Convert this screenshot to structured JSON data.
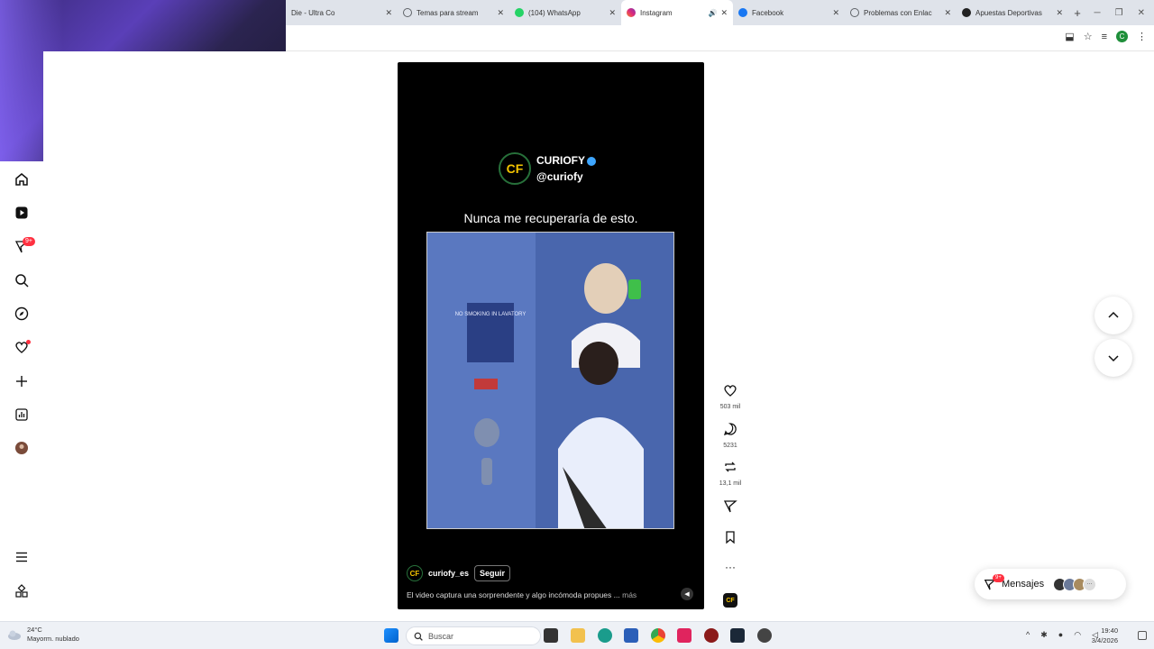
{
  "browser": {
    "tabs": [
      {
        "title": "Die - Ultra Co",
        "color": "#888888",
        "active": false
      },
      {
        "title": "Temas para stream",
        "color": "#5f6368",
        "active": false
      },
      {
        "title": "(104) WhatsApp",
        "color": "#25d366",
        "active": false
      },
      {
        "title": "Instagram",
        "color": "#e1306c",
        "active": true
      },
      {
        "title": "Facebook",
        "color": "#1877f2",
        "active": false
      },
      {
        "title": "Problemas con Enlac",
        "color": "#5f6368",
        "active": false
      },
      {
        "title": "Apuestas Deportivas",
        "color": "#222222",
        "active": false
      }
    ],
    "new_tab": "+",
    "profile_initial": "C"
  },
  "sidebar": {
    "notifications_badge": "9+"
  },
  "reel": {
    "brand_initials": "CF",
    "brand_name": "CURIOFY",
    "brand_handle": "@curiofy",
    "caption_top": "Nunca me recuperaría de esto.",
    "username": "curiofy_es",
    "follow_label": "Seguir",
    "description": "El video captura una sorprendente y algo incómoda propues ...",
    "more_label": "más",
    "video_sign": "NO SMOKING IN LAVATORY"
  },
  "actions": {
    "likes": "503 mil",
    "comments": "5231",
    "reposts": "13,1 mil"
  },
  "messages": {
    "label": "Mensajes",
    "badge": "9+"
  },
  "taskbar": {
    "temperature": "24°C",
    "weather": "Mayorm. nublado",
    "search_placeholder": "Buscar",
    "time": "19:40",
    "date": "3/4/2026"
  }
}
